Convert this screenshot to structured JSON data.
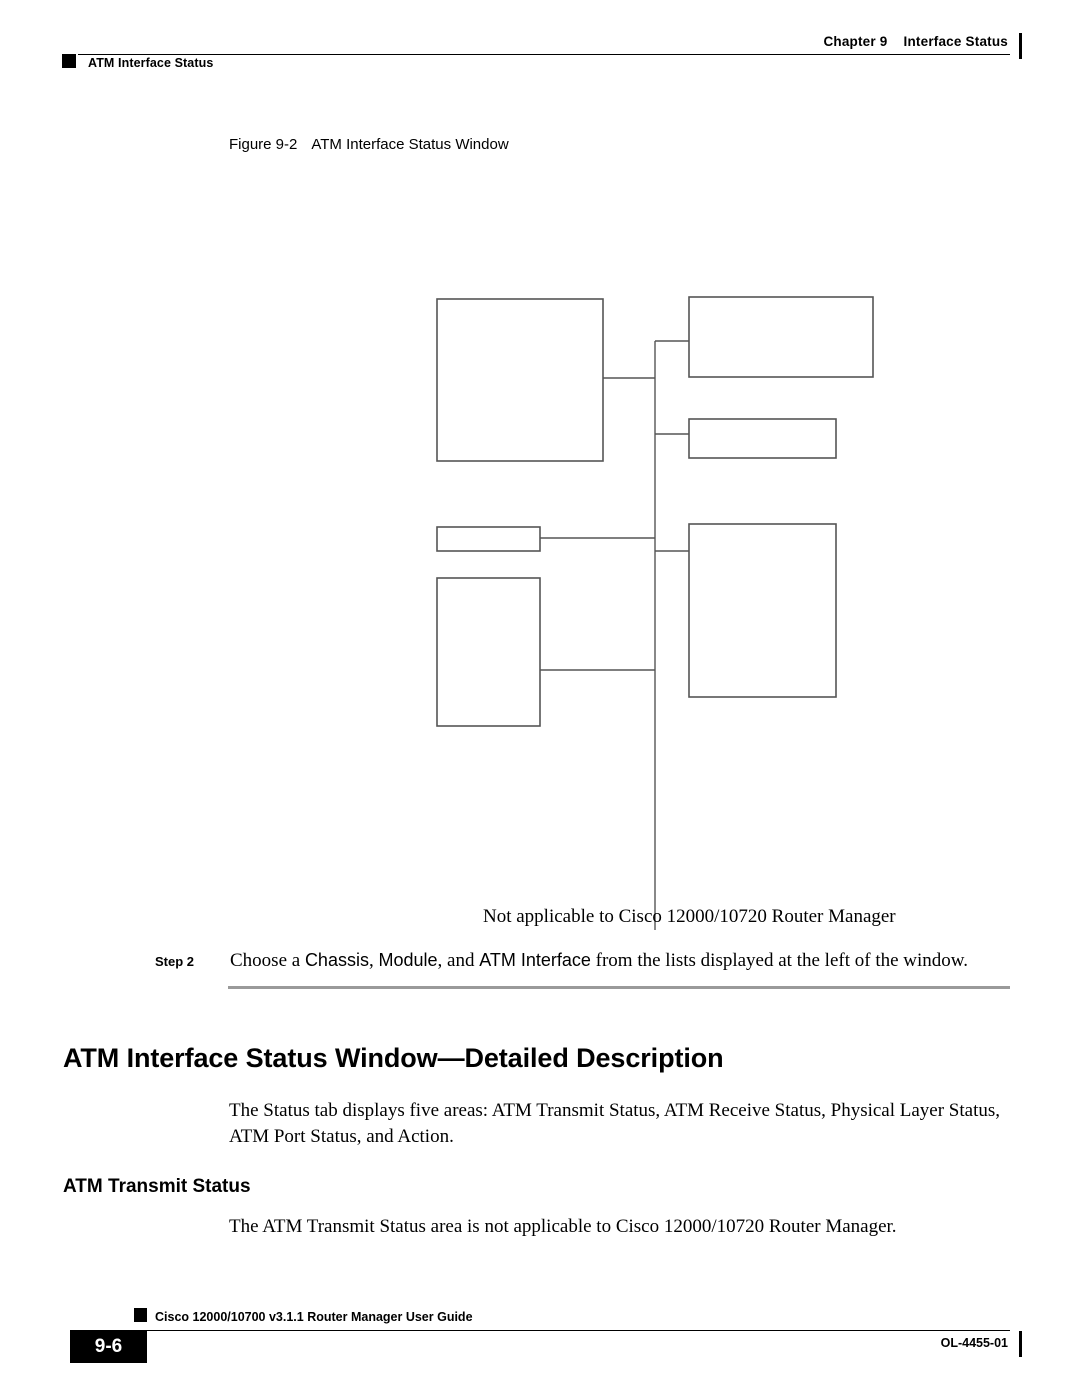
{
  "header": {
    "chapter_label": "Chapter 9",
    "chapter_title": "Interface Status",
    "running_title": "ATM Interface Status"
  },
  "figure": {
    "number": "Figure 9-2",
    "title": "ATM Interface Status Window",
    "callouts": [
      {
        "id": "callout-1",
        "label": ""
      },
      {
        "id": "callout-2",
        "label": ""
      },
      {
        "id": "callout-3",
        "label": ""
      },
      {
        "id": "callout-4",
        "label": ""
      },
      {
        "id": "callout-5",
        "label": ""
      },
      {
        "id": "callout-6",
        "label": ""
      }
    ],
    "note": "Not applicable to Cisco 12000/10720 Router Manager"
  },
  "step": {
    "label": "Step 2",
    "text_before": "Choose a ",
    "ui_chassis": "Chassis",
    "text_comma": ", ",
    "ui_module": "Module",
    "text_and": ", and ",
    "ui_interface": "ATM Interface",
    "text_after": " from the lists displayed at the left of the window."
  },
  "sections": {
    "detailed_description_heading": "ATM Interface Status Window—Detailed Description",
    "detailed_description_body": "The Status tab displays five areas: ATM Transmit Status, ATM Receive Status, Physical Layer Status, ATM Port Status, and Action.",
    "transmit_heading": "ATM Transmit Status",
    "transmit_body": "The ATM Transmit Status area is not applicable to Cisco 12000/10720 Router Manager."
  },
  "footer": {
    "guide_title": "Cisco 12000/10700 v3.1.1 Router Manager User Guide",
    "page_number": "9-6",
    "doc_id": "OL-4455-01"
  },
  "colors": {
    "ink": "#000000",
    "rule_gray": "#9a9a9a",
    "box_stroke": "#555555",
    "page_background": "#ffffff"
  }
}
